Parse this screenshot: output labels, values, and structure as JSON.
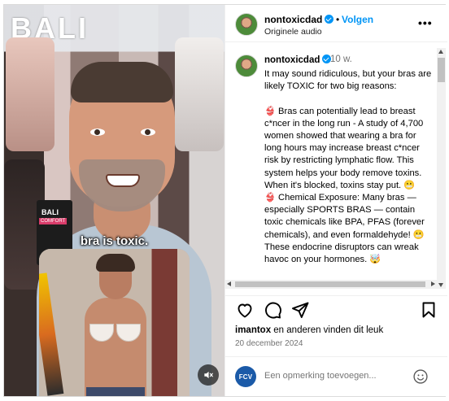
{
  "video": {
    "store_sign": "BALI",
    "product_brand": "BALI",
    "product_tag": "COMFORT",
    "caption": "bra is toxic."
  },
  "header": {
    "username": "nontoxicdad",
    "dot": "•",
    "follow_label": "Volgen",
    "audio_label": "Originele audio",
    "more_label": "•••"
  },
  "post": {
    "username": "nontoxicdad",
    "time_ago": "10 w.",
    "text": "It may sound ridiculous, but your bras are likely TOXIC for two big reasons:\n\n👙 Bras can potentially lead to breast c*ncer in the long run - A study of 4,700 women showed that wearing a bra for long hours may increase breast c*ncer risk by restricting lymphatic flow. This system helps your body remove toxins. When it's blocked, toxins stay put. 😬\n👙 Chemical Exposure: Many bras — especially SPORTS BRAS — contain toxic chemicals like BPA, PFAS (forever chemicals), and even formaldehyde! 😬 These endocrine disruptors can wreak havoc on your hormones. 🤯"
  },
  "actions": {
    "likes_user": "imantox",
    "likes_rest": " en anderen vinden dit leuk",
    "date": "20 december 2024"
  },
  "comment_box": {
    "avatar_label": "FCV",
    "placeholder": "Een opmerking toevoegen..."
  }
}
